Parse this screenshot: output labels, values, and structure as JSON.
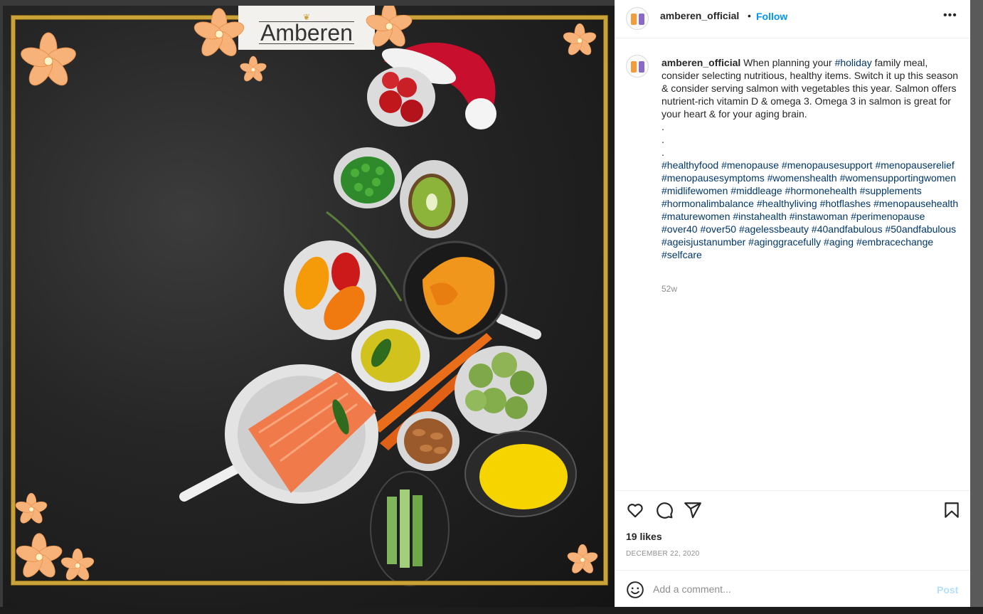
{
  "media": {
    "brand_logo_text": "Amberen",
    "frame_color": "#c9a33a",
    "flower_color": "#f7b27a"
  },
  "post": {
    "username": "amberen_official",
    "follow_label": "Follow",
    "more_icon": "more-horizontal-icon",
    "caption": {
      "username": "amberen_official",
      "text_before_tag": " When planning your ",
      "inline_tag": "#holiday",
      "text_after_tag": " family meal, consider selecting nutritious, healthy items. Switch it up this season & consider serving salmon with vegetables this year. Salmon offers nutrient-rich vitamin D & omega 3. Omega 3 in salmon is great for your heart & for your aging brain.",
      "dots": [
        ".",
        ".",
        "."
      ],
      "hashtags": "#healthyfood #menopause #menopausesupport #menopauserelief #menopausesymptoms #womenshealth #womensupportingwomen #midlifewomen #middleage #hormonehealth #supplements #hormonalimbalance #healthyliving #hotflashes #menopausehealth #maturewomen #instahealth #instawoman #perimenopause #over40 #over50 #agelessbeauty #40andfabulous #50andfabulous #ageisjustanumber #aginggracefully #aging #embracechange #selfcare"
    },
    "time_ago": "52w",
    "likes": "19 likes",
    "date": "DECEMBER 22, 2020",
    "icons": {
      "like": "heart-icon",
      "comment": "comment-icon",
      "share": "send-icon",
      "save": "bookmark-icon",
      "emoji": "emoji-icon"
    }
  },
  "comment": {
    "placeholder": "Add a comment...",
    "post_label": "Post"
  },
  "colors": {
    "link": "#0095f6",
    "hashtag": "#00376b",
    "post_disabled": "#b2dffc"
  }
}
